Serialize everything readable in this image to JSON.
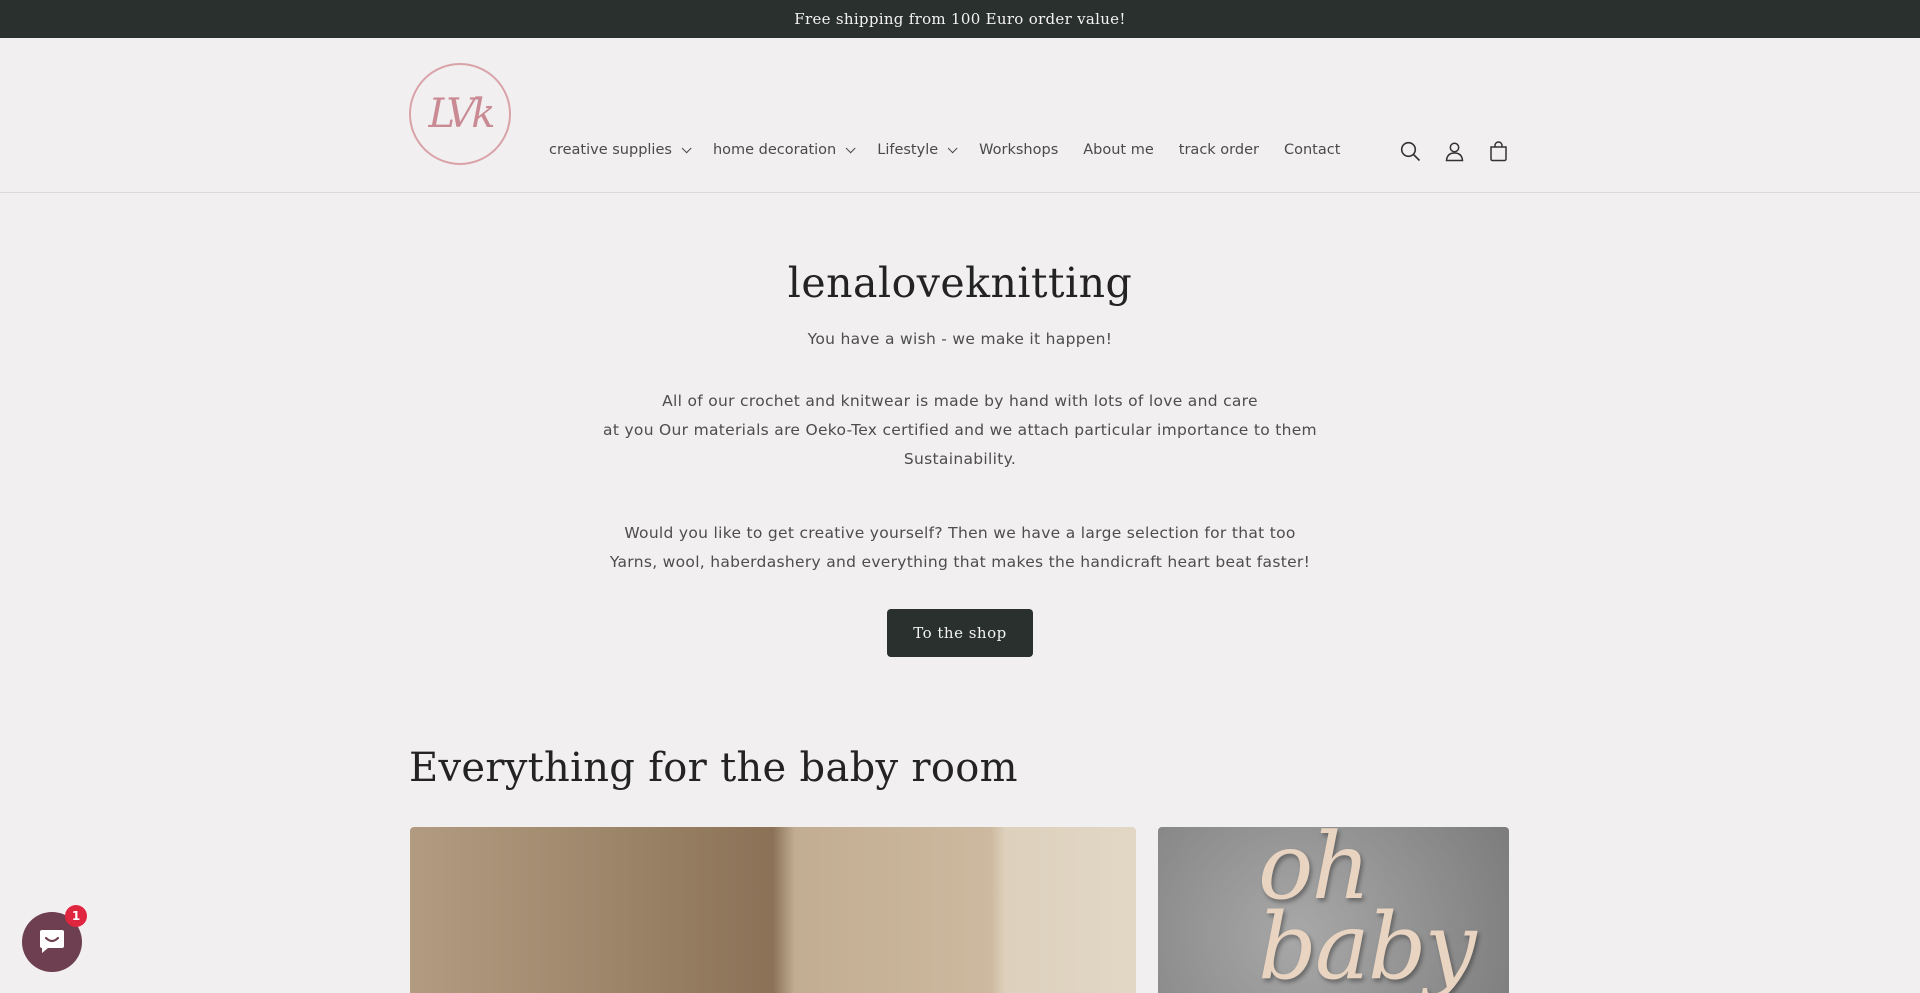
{
  "announcement": "Free shipping from 100 Euro order value!",
  "logo": {
    "text": "LVk"
  },
  "nav": [
    {
      "label": "creative supplies",
      "dropdown": true
    },
    {
      "label": "home decoration",
      "dropdown": true
    },
    {
      "label": "Lifestyle",
      "dropdown": true
    },
    {
      "label": "Workshops",
      "dropdown": false
    },
    {
      "label": "About me",
      "dropdown": false
    },
    {
      "label": "track order",
      "dropdown": false
    },
    {
      "label": "Contact",
      "dropdown": false
    }
  ],
  "header_icons": [
    "search-icon",
    "account-icon",
    "cart-icon"
  ],
  "hero": {
    "title": "lenaloveknitting",
    "tagline": "You have a wish - we make it happen!",
    "para1": [
      "All of our crochet and knitwear is made by hand with lots of love and care",
      "at you Our materials are Oeko-Tex certified and we attach particular importance to them",
      "Sustainability."
    ],
    "para2": [
      "Would you like to get creative yourself? Then we have a large selection for that too",
      "Yarns, wool, haberdashery and everything that makes the handicraft heart beat faster!"
    ],
    "button": "To the shop"
  },
  "section": {
    "title": "Everything for the baby room",
    "card2_text": [
      "oh",
      "baby"
    ]
  },
  "chat": {
    "badge": "1"
  },
  "colors": {
    "dark": "#2a302d",
    "background": "#f1eff0",
    "chat": "#6d3f50",
    "badge": "#e0263e",
    "logo": "#c98a93"
  }
}
